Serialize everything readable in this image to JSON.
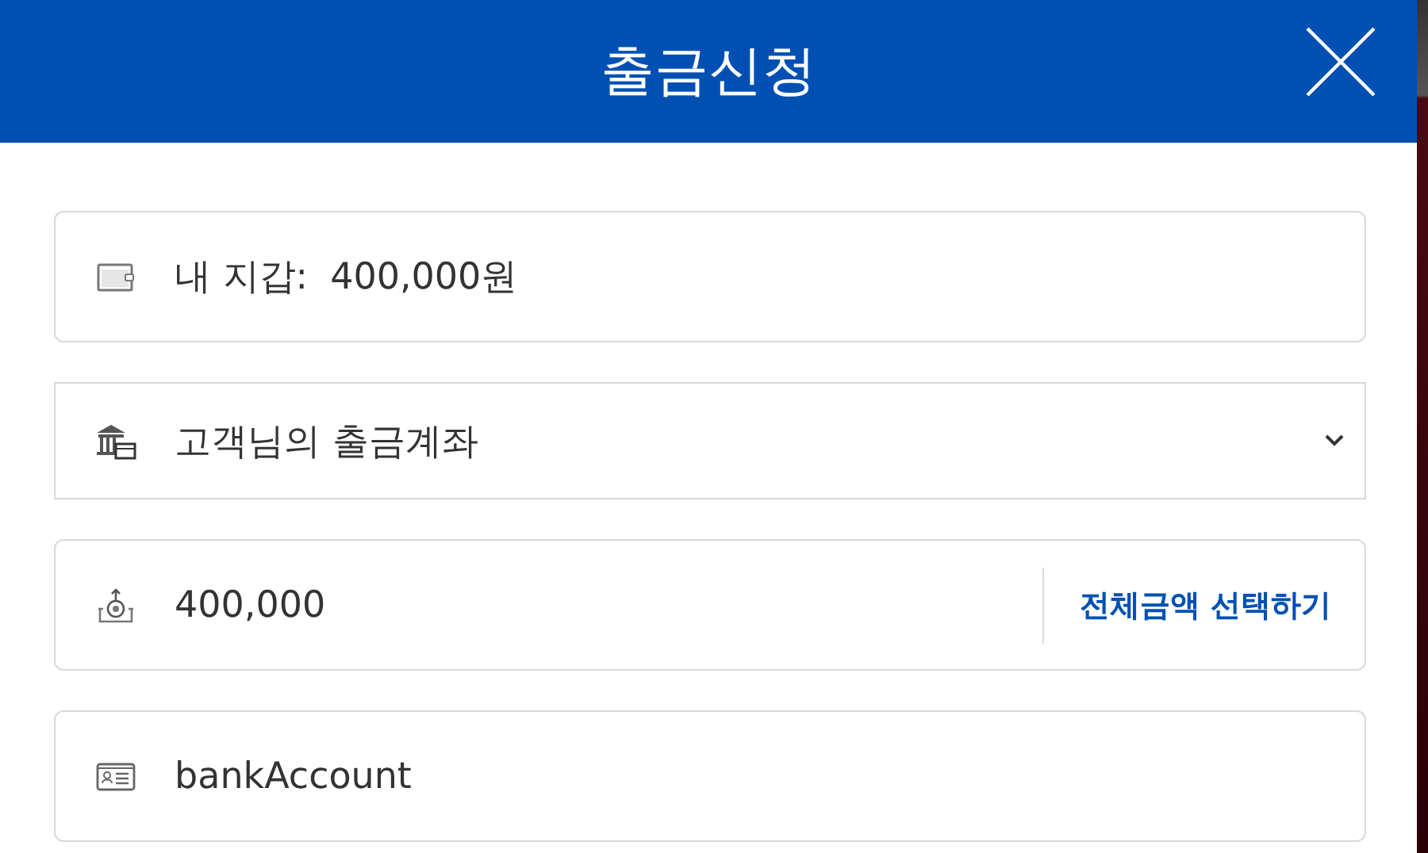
{
  "header": {
    "title": "출금신청"
  },
  "fields": [
    {
      "kind": "info",
      "label": "내 지갑:",
      "value": "400,000원"
    },
    {
      "kind": "select",
      "value": "고객님의 출금계좌"
    },
    {
      "kind": "amount",
      "value": "400,000",
      "action": "전체금액 선택하기"
    },
    {
      "kind": "text",
      "value": "bankAccount"
    }
  ]
}
